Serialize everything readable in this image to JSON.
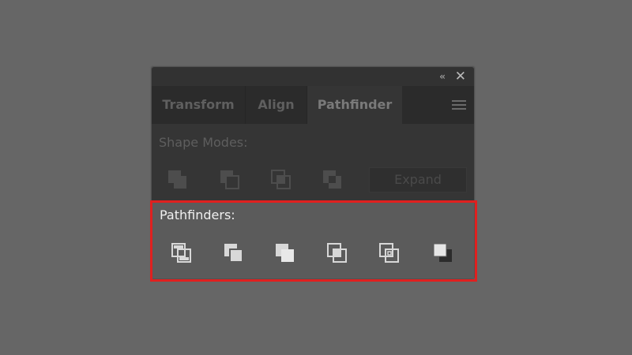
{
  "panel": {
    "collapse_glyph": "‹‹",
    "close_glyph": "✕",
    "tabs": [
      {
        "label": "Transform",
        "active": false
      },
      {
        "label": "Align",
        "active": false
      },
      {
        "label": "Pathfinder",
        "active": true
      }
    ],
    "menu_icon": "hamburger-menu-icon"
  },
  "shape_modes": {
    "label": "Shape Modes:",
    "buttons": [
      {
        "name": "unite",
        "icon": "shape-mode-unite-icon"
      },
      {
        "name": "minus-front",
        "icon": "shape-mode-minus-front-icon"
      },
      {
        "name": "intersect",
        "icon": "shape-mode-intersect-icon"
      },
      {
        "name": "exclude",
        "icon": "shape-mode-exclude-icon"
      }
    ],
    "expand_label": "Expand"
  },
  "pathfinders": {
    "label": "Pathfinders:",
    "buttons": [
      {
        "name": "divide",
        "icon": "pathfinder-divide-icon"
      },
      {
        "name": "trim",
        "icon": "pathfinder-trim-icon"
      },
      {
        "name": "merge",
        "icon": "pathfinder-merge-icon"
      },
      {
        "name": "crop",
        "icon": "pathfinder-crop-icon"
      },
      {
        "name": "outline",
        "icon": "pathfinder-outline-icon"
      },
      {
        "name": "minus-back",
        "icon": "pathfinder-minus-back-icon"
      }
    ]
  },
  "colors": {
    "background": "#666666",
    "panel_dark": "#353535",
    "tab_bar": "#2b2b2b",
    "pathfinders_bg": "#5b5b5b",
    "highlight": "#e0201f"
  }
}
